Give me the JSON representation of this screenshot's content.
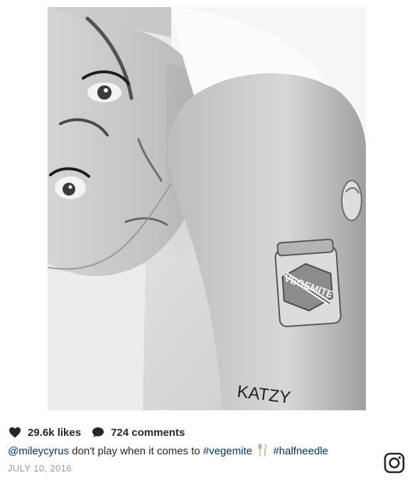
{
  "post": {
    "photo_icon": "post-photo",
    "likes": "29.6k likes",
    "comments": "724 comments",
    "caption": {
      "username": "@mileycyrus",
      "text": " don't play when it comes to ",
      "hashtag_1": "#vegemite",
      "hashtag_2": "#halfneedle"
    },
    "date": "JULY 10, 2016",
    "brand_icon": "instagram-icon"
  },
  "colors": {
    "link": "#003569",
    "text": "#262626",
    "muted": "#999999",
    "background": "#ffffff"
  }
}
